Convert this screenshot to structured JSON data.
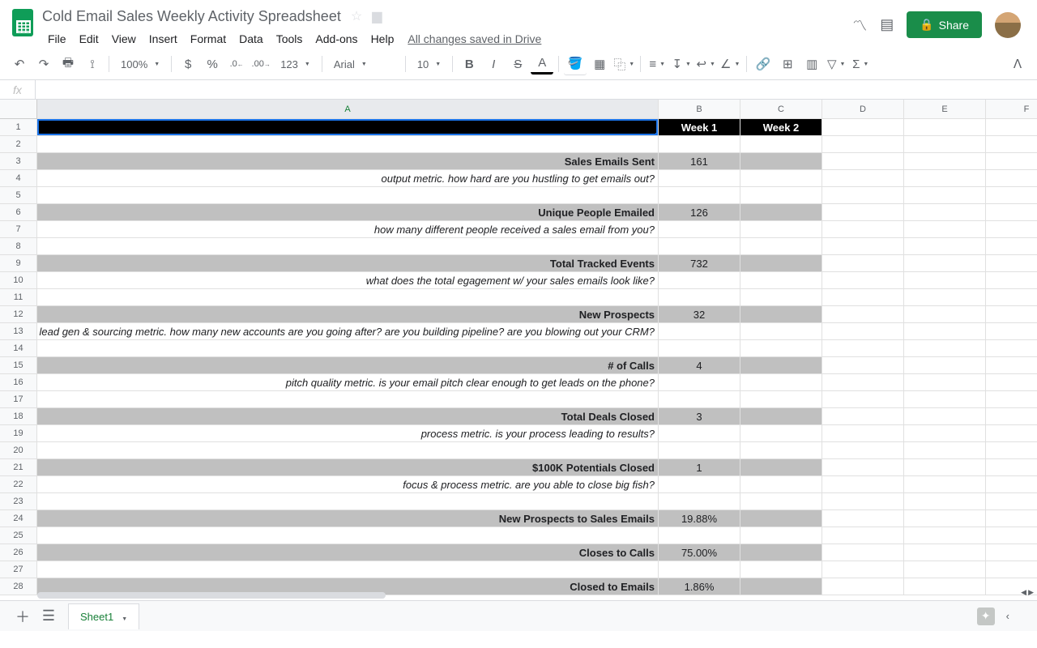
{
  "doc_title": "Cold Email Sales Weekly Activity Spreadsheet",
  "menubar": [
    "File",
    "Edit",
    "View",
    "Insert",
    "Format",
    "Data",
    "Tools",
    "Add-ons",
    "Help"
  ],
  "saved_status": "All changes saved in Drive",
  "share_label": "Share",
  "toolbar": {
    "zoom": "100%",
    "currency": "$",
    "percent": "%",
    "dec_dec": ".0",
    "inc_dec": ".00",
    "format": "123",
    "font": "Arial",
    "size": "10"
  },
  "columns": [
    "A",
    "B",
    "C",
    "D",
    "E",
    "F"
  ],
  "headers": {
    "week1": "Week 1",
    "week2": "Week 2"
  },
  "rows": [
    {
      "n": 1,
      "type": "header"
    },
    {
      "n": 2,
      "type": "blank"
    },
    {
      "n": 3,
      "type": "metric",
      "label": "Sales Emails Sent",
      "w1": "161"
    },
    {
      "n": 4,
      "type": "desc",
      "text": "output metric. how hard are you hustling to get emails out?"
    },
    {
      "n": 5,
      "type": "blank"
    },
    {
      "n": 6,
      "type": "metric",
      "label": "Unique People Emailed",
      "w1": "126"
    },
    {
      "n": 7,
      "type": "desc",
      "text": "how many different people received a sales email from you?"
    },
    {
      "n": 8,
      "type": "blank"
    },
    {
      "n": 9,
      "type": "metric",
      "label": "Total Tracked Events",
      "w1": "732"
    },
    {
      "n": 10,
      "type": "desc",
      "text": "what does the total egagement w/ your sales emails look like?"
    },
    {
      "n": 11,
      "type": "blank"
    },
    {
      "n": 12,
      "type": "metric",
      "label": "New Prospects",
      "w1": "32"
    },
    {
      "n": 13,
      "type": "desc",
      "text": "lead gen & sourcing metric. how many new accounts are you going after? are you building pipeline? are you blowing out your CRM?"
    },
    {
      "n": 14,
      "type": "blank"
    },
    {
      "n": 15,
      "type": "metric",
      "label": "# of Calls",
      "w1": "4"
    },
    {
      "n": 16,
      "type": "desc",
      "text": "pitch quality metric. is your email pitch clear enough to get leads on the phone?"
    },
    {
      "n": 17,
      "type": "blank"
    },
    {
      "n": 18,
      "type": "metric",
      "label": "Total Deals Closed",
      "w1": "3"
    },
    {
      "n": 19,
      "type": "desc",
      "text": "process metric. is your process leading to results?"
    },
    {
      "n": 20,
      "type": "blank"
    },
    {
      "n": 21,
      "type": "metric",
      "label": "$100K Potentials Closed",
      "w1": "1"
    },
    {
      "n": 22,
      "type": "desc",
      "text": "focus & process metric. are you able to close big fish?"
    },
    {
      "n": 23,
      "type": "blank"
    },
    {
      "n": 24,
      "type": "metric",
      "label": "New Prospects to Sales Emails",
      "w1": "19.88%"
    },
    {
      "n": 25,
      "type": "blank"
    },
    {
      "n": 26,
      "type": "metric",
      "label": "Closes to Calls",
      "w1": "75.00%"
    },
    {
      "n": 27,
      "type": "blank"
    },
    {
      "n": 28,
      "type": "metric",
      "label": "Closed to Emails",
      "w1": "1.86%"
    }
  ],
  "sheet_name": "Sheet1",
  "fx_label": "fx"
}
